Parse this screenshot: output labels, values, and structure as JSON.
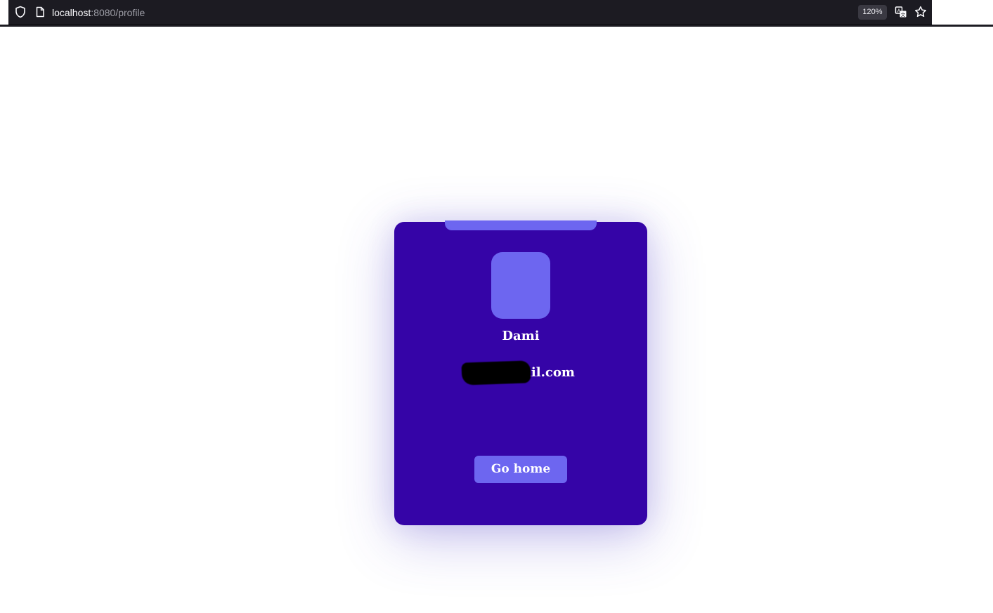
{
  "browser": {
    "url_host": "localhost",
    "url_path": ":8080/profile",
    "zoom_level": "120%",
    "icons": {
      "shield": "shield-icon",
      "page": "page-icon",
      "translate": "translate-icon",
      "bookmark": "star-icon"
    }
  },
  "profile": {
    "name": "Dami",
    "email": "da        @gmail.com",
    "email_redacted": true,
    "go_home_label": "Go home"
  },
  "colors": {
    "card_background": "#3504a7",
    "accent": "#6d66f0",
    "text": "#ffffff",
    "browser_bar": "#1c1b22"
  }
}
